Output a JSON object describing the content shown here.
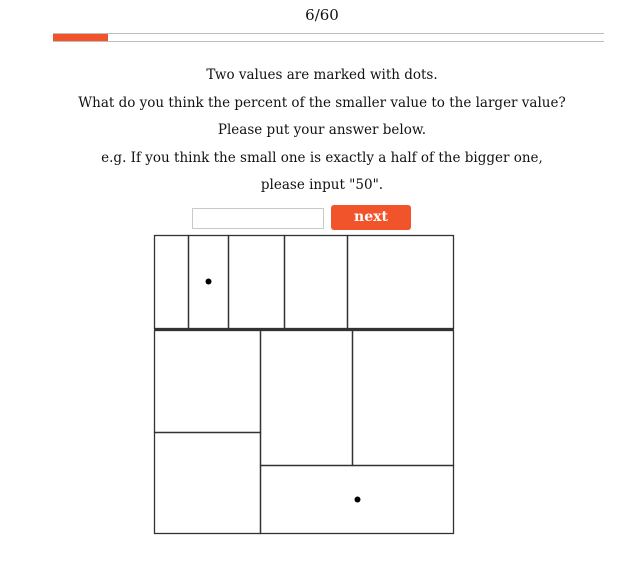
{
  "progress": {
    "label": "6/60",
    "current": 6,
    "total": 60,
    "fraction": 0.1,
    "color": "#f1532b"
  },
  "instructions": [
    "Two values are marked with dots.",
    "What do you think the percent of the smaller value to the larger value?",
    "Please put your answer below.",
    "e.g. If you think the small one is exactly a half of the bigger one,",
    "please input \"50\"."
  ],
  "answer": {
    "value": "",
    "placeholder": ""
  },
  "next_button": {
    "label": "next",
    "color": "#f1532b"
  },
  "chart_data": {
    "type": "treemap",
    "title": "",
    "cells": 12,
    "marked_cells": 2
  }
}
